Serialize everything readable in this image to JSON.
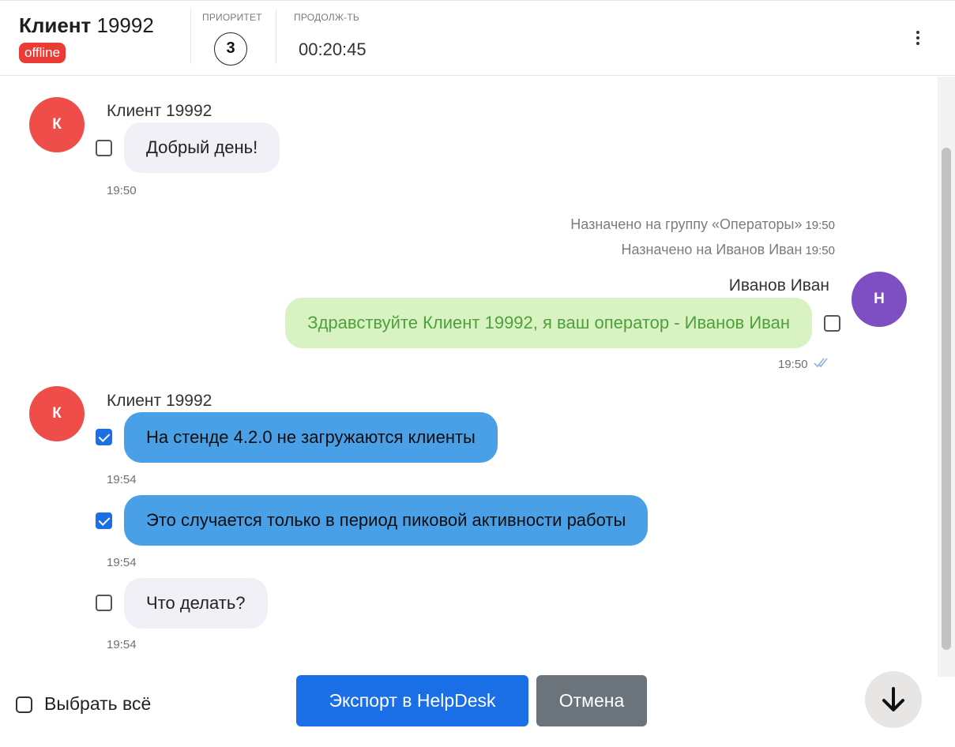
{
  "header": {
    "client_name_bold": "Клиент",
    "client_name_num": "19992",
    "status": "offline",
    "priority_label": "ПРИОРИТЕТ",
    "priority_value": "3",
    "duration_label": "ПРОДОЛЖ-ТЬ",
    "duration_value": "00:20:45",
    "menu_icon": "more-vertical-icon"
  },
  "messages": [
    {
      "sender": "Клиент 19992",
      "avatar": "К",
      "text": "Добрый день!",
      "time": "19:50",
      "checked": false
    },
    {
      "system": "Назначено на группу «Операторы»",
      "time": "19:50"
    },
    {
      "system": "Назначено на Иванов Иван",
      "time": "19:50"
    },
    {
      "sender": "Иванов Иван",
      "avatar": "Н",
      "text": "Здравствуйте Клиент 19992, я ваш оператор - Иванов Иван",
      "time": "19:50",
      "checked": false
    },
    {
      "sender": "Клиент 19992",
      "avatar": "К",
      "text": "На стенде 4.2.0 не загружаются клиенты",
      "time": "19:54",
      "checked": true
    },
    {
      "text": "Это случается только в период пиковой активности работы",
      "time": "19:54",
      "checked": true
    },
    {
      "text": "Что делать?",
      "time": "19:54",
      "checked": false
    }
  ],
  "footer": {
    "select_all_label": "Выбрать всё",
    "export_label": "Экспорт в HelpDesk",
    "cancel_label": "Отмена"
  },
  "colors": {
    "accent": "#1a6fe6",
    "offline": "#ea3b34",
    "client_avatar": "#ee4d4a",
    "operator_avatar": "#7e4fc2",
    "selected_bubble": "#4aa0e6",
    "operator_bubble": "#d9f2c2"
  }
}
